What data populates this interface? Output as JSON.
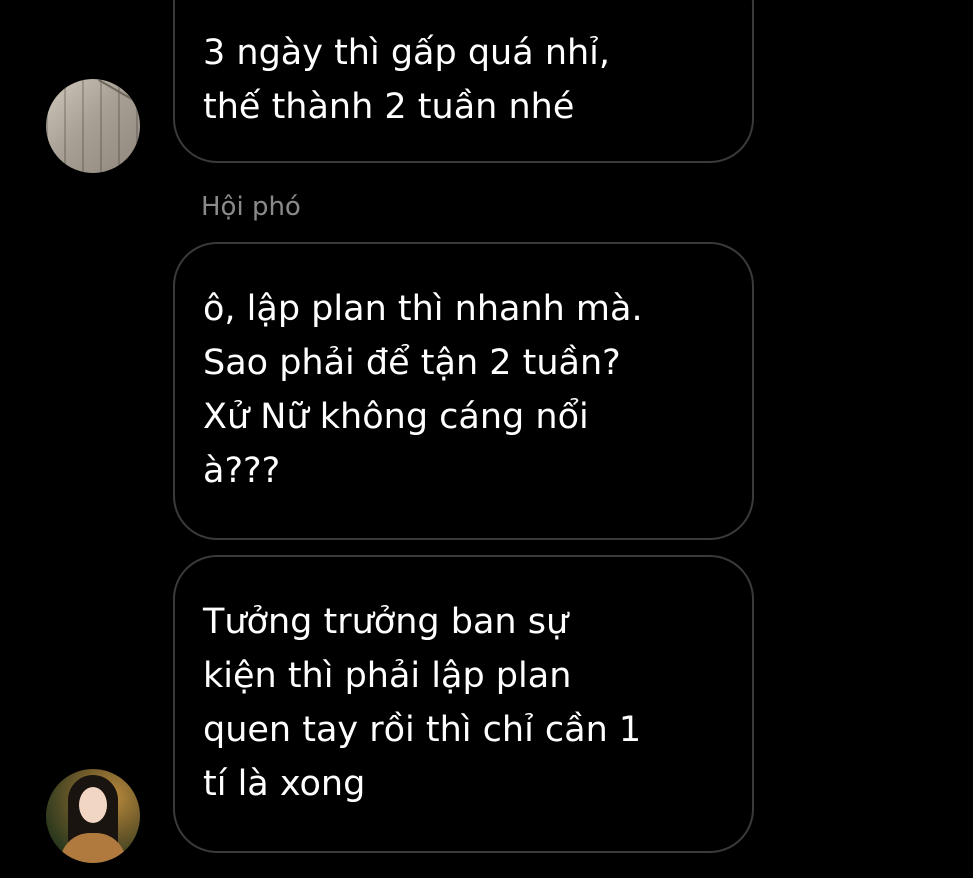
{
  "messages": [
    {
      "lines": [
        "3 ngày thì gấp quá nhỉ,",
        "thế thành 2 tuần nhé"
      ]
    },
    {
      "sender": "Hội phó",
      "lines": [
        "ô, lập plan thì nhanh mà.",
        "Sao phải để tận 2 tuần?",
        "Xử Nữ không cáng nổi",
        "à???"
      ]
    },
    {
      "lines": [
        "Tưởng trưởng ban sự",
        "kiện thì phải lập plan",
        "quen tay rồi thì chỉ cần 1",
        "tí là xong"
      ]
    }
  ],
  "avatars": {
    "first": "wooden-plank-photo",
    "second": "woman-portrait-photo"
  }
}
